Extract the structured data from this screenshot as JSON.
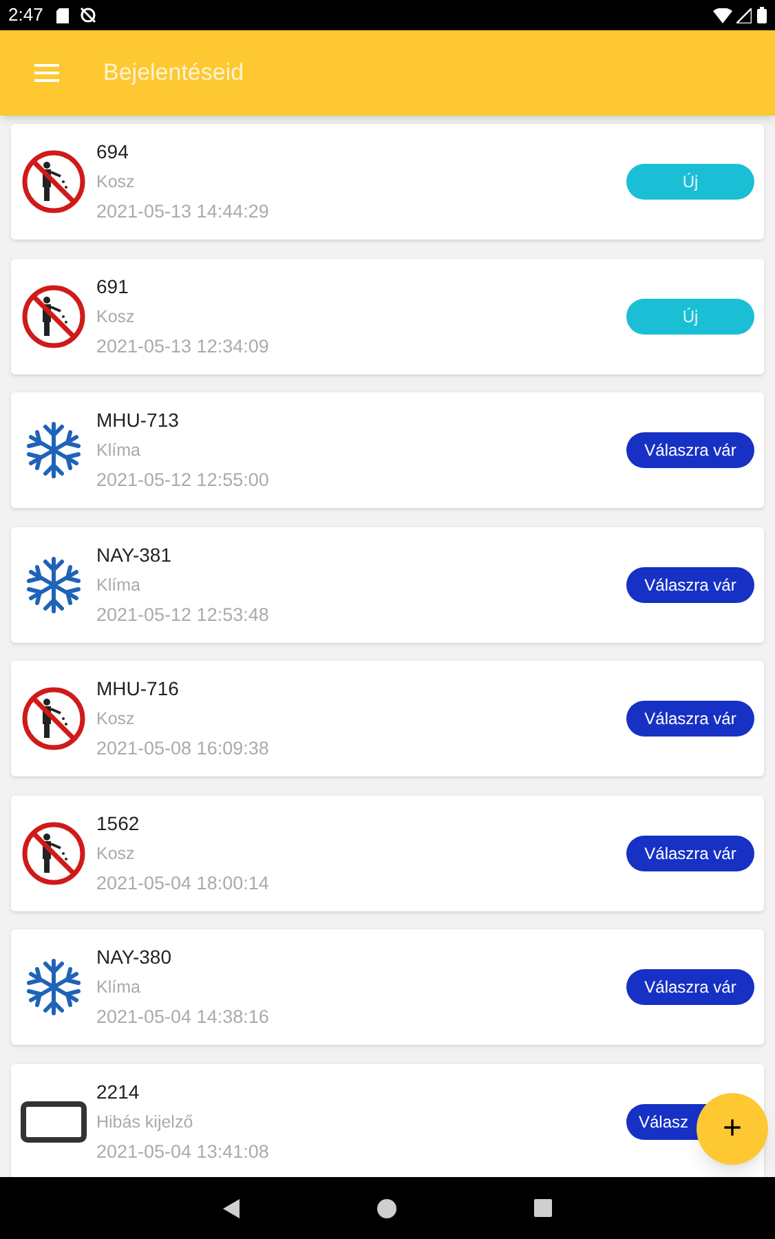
{
  "status_bar": {
    "time": "2:47"
  },
  "app_bar": {
    "title": "Bejelentéseid"
  },
  "reports": [
    {
      "kind": "trash",
      "title": "694",
      "category": "Kosz",
      "date": "2021-05-13 14:44:29",
      "status": {
        "kind": "new",
        "label": "Új"
      }
    },
    {
      "kind": "trash",
      "title": "691",
      "category": "Kosz",
      "date": "2021-05-13 12:34:09",
      "status": {
        "kind": "new",
        "label": "Új"
      }
    },
    {
      "kind": "snow",
      "title": "MHU-713",
      "category": "Klíma",
      "date": "2021-05-12 12:55:00",
      "status": {
        "kind": "waiting",
        "label": "Válaszra vár"
      }
    },
    {
      "kind": "snow",
      "title": "NAY-381",
      "category": "Klíma",
      "date": "2021-05-12 12:53:48",
      "status": {
        "kind": "waiting",
        "label": "Válaszra vár"
      }
    },
    {
      "kind": "trash",
      "title": "MHU-716",
      "category": "Kosz",
      "date": "2021-05-08 16:09:38",
      "status": {
        "kind": "waiting",
        "label": "Válaszra vár"
      }
    },
    {
      "kind": "trash",
      "title": "1562",
      "category": "Kosz",
      "date": "2021-05-04 18:00:14",
      "status": {
        "kind": "waiting",
        "label": "Válaszra vár"
      }
    },
    {
      "kind": "snow",
      "title": "NAY-380",
      "category": "Klíma",
      "date": "2021-05-04 14:38:16",
      "status": {
        "kind": "waiting",
        "label": "Válaszra vár"
      }
    },
    {
      "kind": "display",
      "title": "2214",
      "category": "Hibás kijelző",
      "date": "2021-05-04 13:41:08",
      "status": {
        "kind": "waiting",
        "label": "Válasz"
      }
    }
  ],
  "fab": {
    "label": "+"
  }
}
